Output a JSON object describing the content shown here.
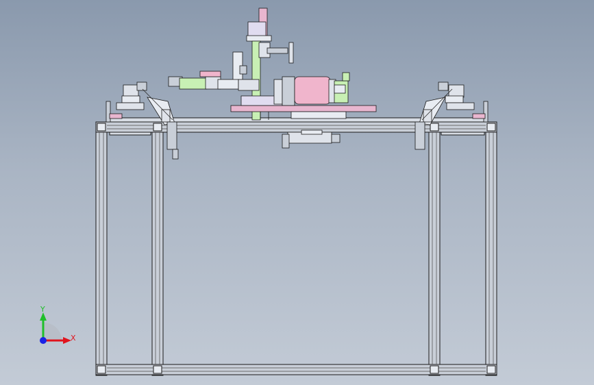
{
  "viewport": {
    "view": "front"
  },
  "triad": {
    "x_label": "X",
    "y_label": "Y",
    "x_color": "#e0141e",
    "y_color": "#1fbf2a",
    "z_color": "#1a22e6"
  },
  "colors": {
    "frame_fill": "#c9cfd8",
    "frame_edge": "#1a1a1a",
    "pink_plate": "#e8b6cf",
    "motor_pink": "#f0b5cc",
    "green_part": "#c8f0b4",
    "lavender": "#e0dcf0",
    "yellow_part": "#f4ec9a"
  }
}
